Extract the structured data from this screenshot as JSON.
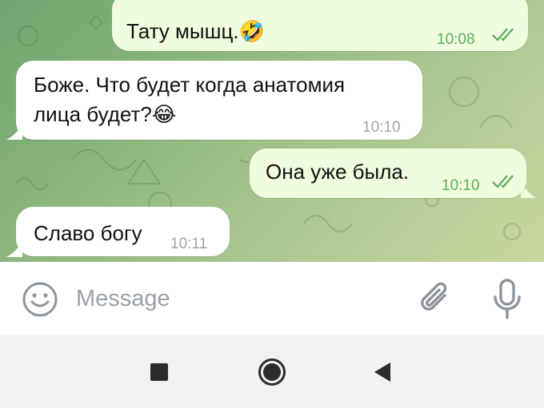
{
  "messages": [
    {
      "text": "Тату мышц.🤣",
      "time": "10:08",
      "direction": "outgoing",
      "read": true
    },
    {
      "line1": "Боже. Что будет когда анатомия",
      "line2": "лица будет?😂",
      "time": "10:10",
      "direction": "incoming"
    },
    {
      "text": "Она уже была.",
      "time": "10:10",
      "direction": "outgoing",
      "read": true
    },
    {
      "text": "Славо богу",
      "time": "10:11",
      "direction": "incoming"
    }
  ],
  "composer": {
    "placeholder": "Message",
    "icons": [
      "emoji-icon",
      "attach-icon",
      "microphone-icon"
    ]
  },
  "navigation": {
    "icons": [
      "recents-icon",
      "home-icon",
      "back-icon"
    ]
  },
  "colors": {
    "outgoing_bubble": "#effdde",
    "incoming_bubble": "#ffffff",
    "outgoing_time": "#5dad5b",
    "icon_gray": "#8e959b"
  }
}
